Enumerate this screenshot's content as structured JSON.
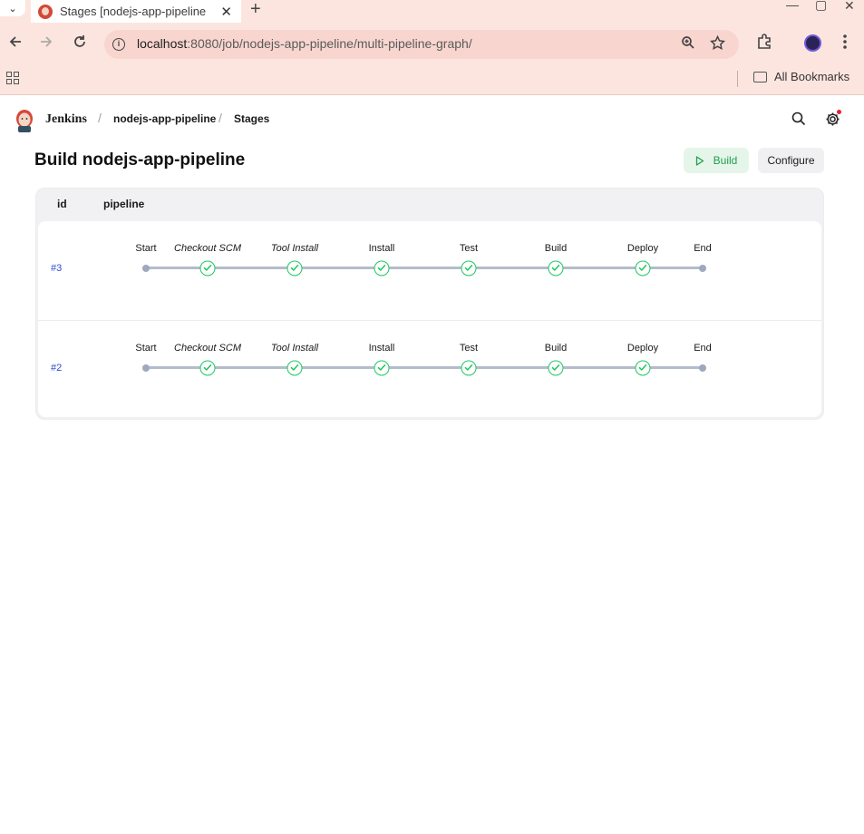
{
  "browser": {
    "tab_title": "Stages [nodejs-app-pipeline",
    "url_host": "localhost",
    "url_rest": ":8080/job/nodejs-app-pipeline/multi-pipeline-graph/",
    "bookmarks_label": "All Bookmarks"
  },
  "header": {
    "app_name": "Jenkins",
    "breadcrumbs": [
      "nodejs-app-pipeline",
      "Stages"
    ]
  },
  "page": {
    "title": "Build nodejs-app-pipeline",
    "build_label": "Build",
    "configure_label": "Configure"
  },
  "table": {
    "columns": [
      "id",
      "pipeline"
    ],
    "runs": [
      {
        "id": "#3",
        "stages": [
          {
            "name": "Start",
            "type": "marker"
          },
          {
            "name": "Checkout SCM",
            "type": "success",
            "italic": true
          },
          {
            "name": "Tool Install",
            "type": "success",
            "italic": true
          },
          {
            "name": "Install",
            "type": "success"
          },
          {
            "name": "Test",
            "type": "success"
          },
          {
            "name": "Build",
            "type": "success"
          },
          {
            "name": "Deploy",
            "type": "success"
          },
          {
            "name": "End",
            "type": "marker"
          }
        ]
      },
      {
        "id": "#2",
        "stages": [
          {
            "name": "Start",
            "type": "marker"
          },
          {
            "name": "Checkout SCM",
            "type": "success",
            "italic": true
          },
          {
            "name": "Tool Install",
            "type": "success",
            "italic": true
          },
          {
            "name": "Install",
            "type": "success"
          },
          {
            "name": "Test",
            "type": "success"
          },
          {
            "name": "Build",
            "type": "success"
          },
          {
            "name": "Deploy",
            "type": "success"
          },
          {
            "name": "End",
            "type": "marker"
          }
        ]
      }
    ]
  },
  "colors": {
    "success": "#1ec760",
    "link": "#2b4bd6",
    "track": "#b3bccb"
  }
}
